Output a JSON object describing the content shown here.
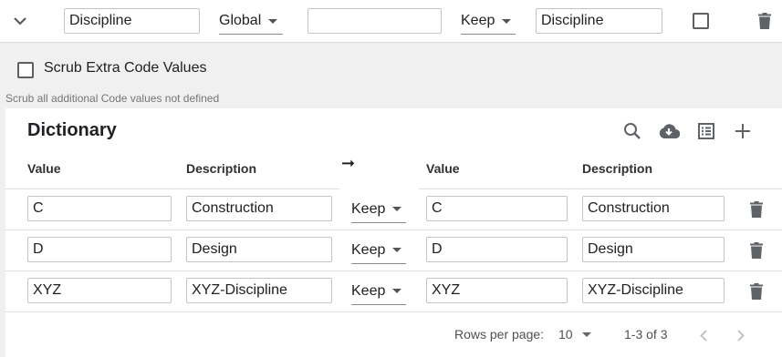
{
  "mapping_row": {
    "source_field": "Discipline",
    "scope": "Global",
    "middle_field": "",
    "action": "Keep",
    "target_field": "Discipline"
  },
  "scrub": {
    "label": "Scrub Extra Code Values",
    "help": "Scrub all additional Code values not defined",
    "checked": false
  },
  "dictionary": {
    "title": "Dictionary",
    "toolbar_icons": [
      "search-icon",
      "cloud-download-icon",
      "list-view-icon",
      "add-icon"
    ],
    "headers": {
      "value": "Value",
      "description": "Description",
      "arrow": "➞",
      "target_value": "Value",
      "target_description": "Description"
    },
    "rows": [
      {
        "value": "C",
        "description": "Construction",
        "action": "Keep",
        "target_value": "C",
        "target_description": "Construction"
      },
      {
        "value": "D",
        "description": "Design",
        "action": "Keep",
        "target_value": "D",
        "target_description": "Design"
      },
      {
        "value": "XYZ",
        "description": "XYZ-Discipline",
        "action": "Keep",
        "target_value": "XYZ",
        "target_description": "XYZ-Discipline"
      }
    ],
    "footer": {
      "rows_per_page_label": "Rows per page:",
      "rows_per_page": "10",
      "range": "1-3 of 3"
    }
  },
  "colors": {
    "background": "#f0f0f0",
    "card": "#ffffff",
    "border": "#c4c4c4",
    "icon": "#5f6368"
  }
}
